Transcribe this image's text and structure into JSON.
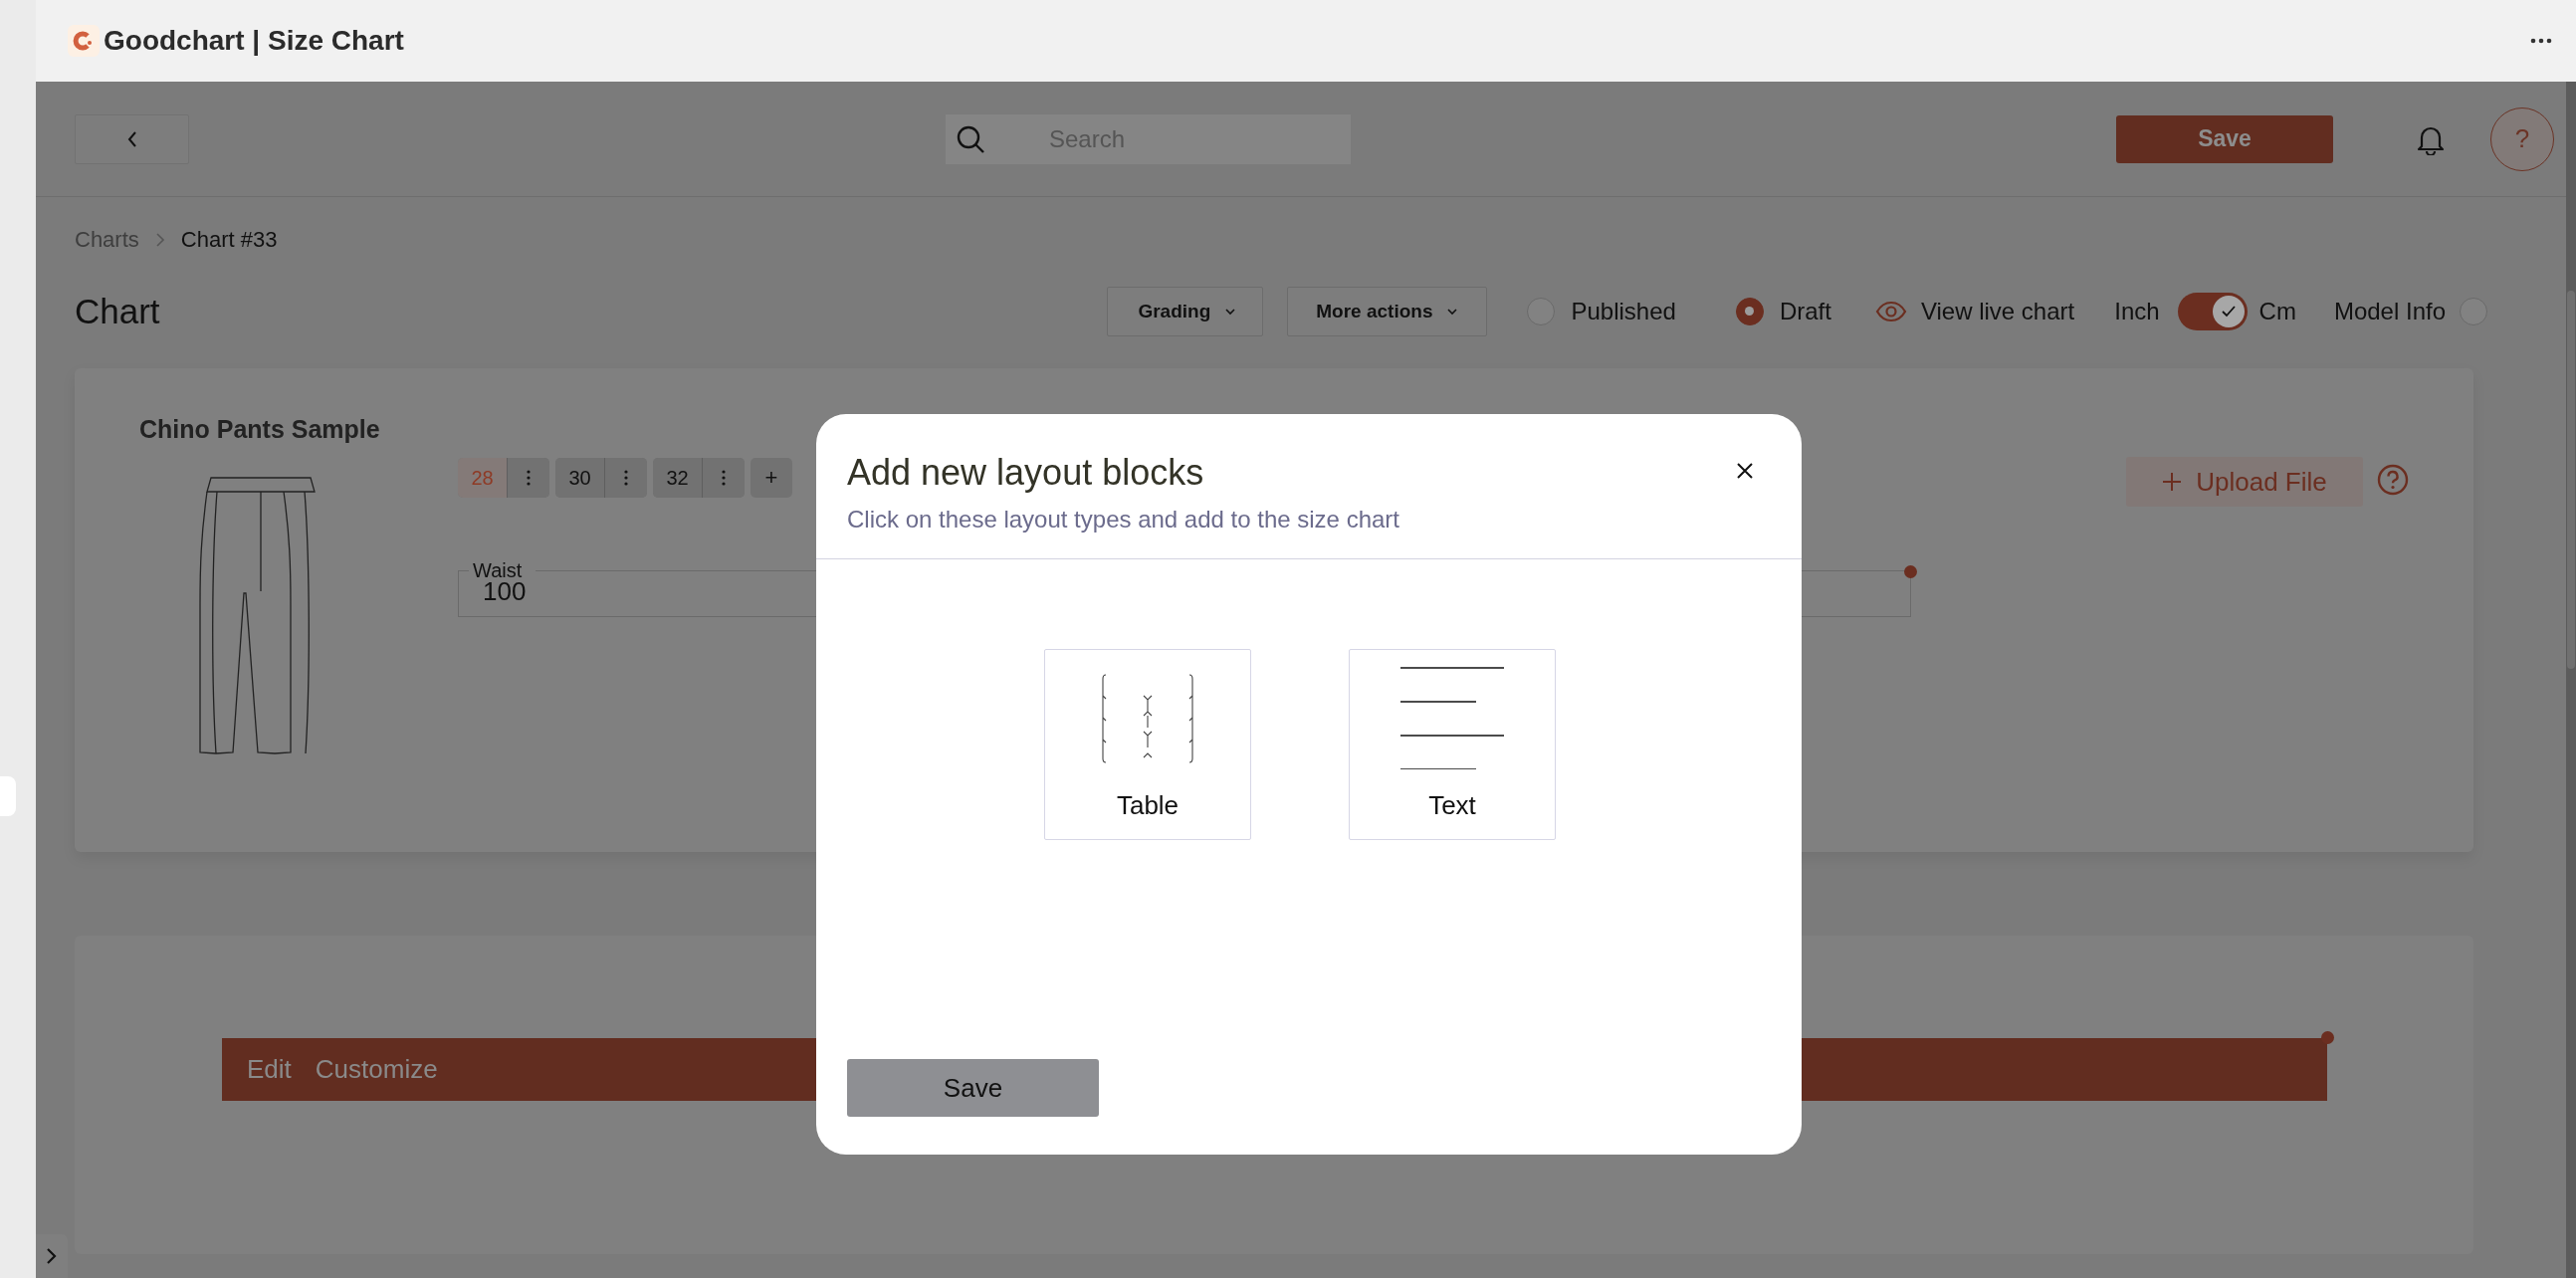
{
  "app": {
    "title": "Goodchart | Size Chart"
  },
  "toolbar": {
    "search": {
      "placeholder": "Search"
    },
    "save_button": "Save",
    "help_button": "?"
  },
  "breadcrumb": [
    {
      "label": "Charts",
      "current": false
    },
    {
      "label": "Chart #33",
      "current": true
    }
  ],
  "chart_header": {
    "title": "Chart",
    "buttons": [
      "Grading",
      "More actions"
    ],
    "status_options": [
      {
        "label": "Published",
        "selected": false
      },
      {
        "label": "Draft",
        "selected": true
      }
    ],
    "view_link": "View live chart",
    "units": {
      "left": "Inch",
      "right": "Cm",
      "on": true
    },
    "model_info": {
      "label": "Model Info",
      "on": false
    }
  },
  "product": {
    "name": "Chino Pants Sample",
    "sizes": [
      {
        "label": "28",
        "selected": true
      },
      {
        "label": "30",
        "selected": false
      },
      {
        "label": "32",
        "selected": false
      }
    ],
    "add_size": "+",
    "measurements": [
      {
        "label": "Waist",
        "value": "100"
      }
    ],
    "upload_button": "Upload File"
  },
  "layout_block": {
    "actions": [
      "Edit",
      "Customize"
    ]
  },
  "modal": {
    "title": "Add new layout blocks",
    "subtitle": "Click on these layout types and add to the size chart",
    "options": [
      {
        "kind": "table",
        "label": "Table"
      },
      {
        "kind": "text",
        "label": "Text"
      }
    ],
    "save_button": "Save"
  }
}
